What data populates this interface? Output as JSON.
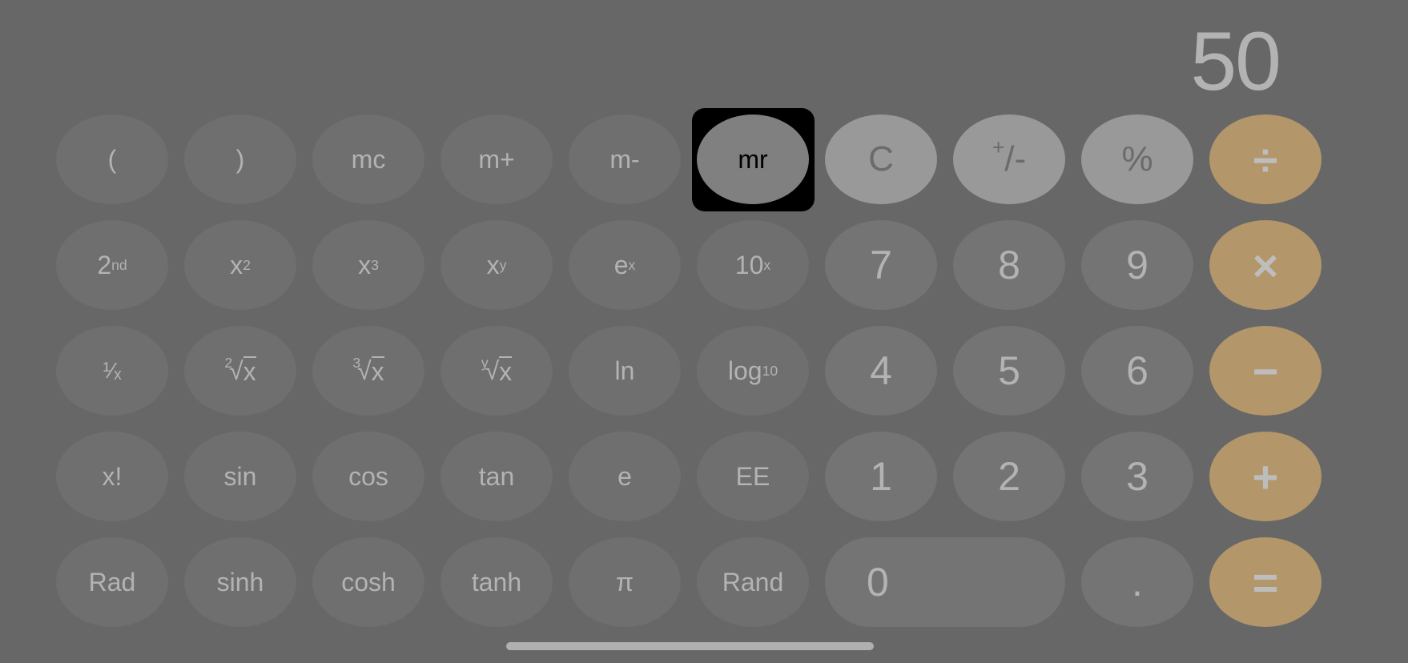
{
  "display": {
    "value": "50"
  },
  "colors": {
    "background": "#676767",
    "function_key": "#6f6f6f",
    "digit_key": "#747474",
    "light_key": "#999999",
    "operator_key": "#b39669",
    "focused_key": "#808080",
    "text": "#b3b3b3"
  },
  "keys": {
    "row1": {
      "open_paren": "(",
      "close_paren": ")",
      "mc": "mc",
      "m_plus": "m+",
      "m_minus": "m-",
      "mr": "mr",
      "clear": "C",
      "plus_minus_sup": "+",
      "plus_minus_rest": "/-",
      "percent": "%",
      "divide": "÷"
    },
    "row2": {
      "second_base": "2",
      "second_sup": "nd",
      "x_sq_base": "x",
      "x_sq_sup": "2",
      "x_cube_base": "x",
      "x_cube_sup": "3",
      "x_y_base": "x",
      "x_y_sup": "y",
      "e_x_base": "e",
      "e_x_sup": "x",
      "ten_x_base": "10",
      "ten_x_sup": "x",
      "seven": "7",
      "eight": "8",
      "nine": "9",
      "multiply": "×"
    },
    "row3": {
      "reciprocal": "¹⁄ₓ",
      "sqrt_idx": "2",
      "cbrt_idx": "3",
      "yroot_idx": "y",
      "root_radical": "√",
      "root_arg": "x",
      "ln": "ln",
      "log_base": "log",
      "log_sub": "10",
      "four": "4",
      "five": "5",
      "six": "6",
      "minus": "−"
    },
    "row4": {
      "factorial": "x!",
      "sin": "sin",
      "cos": "cos",
      "tan": "tan",
      "e": "e",
      "ee": "EE",
      "one": "1",
      "two": "2",
      "three": "3",
      "plus": "+"
    },
    "row5": {
      "rad": "Rad",
      "sinh": "sinh",
      "cosh": "cosh",
      "tanh": "tanh",
      "pi": "π",
      "rand": "Rand",
      "zero": "0",
      "decimal": ".",
      "equals": "="
    }
  },
  "focus": {
    "focused_key": "mr"
  }
}
